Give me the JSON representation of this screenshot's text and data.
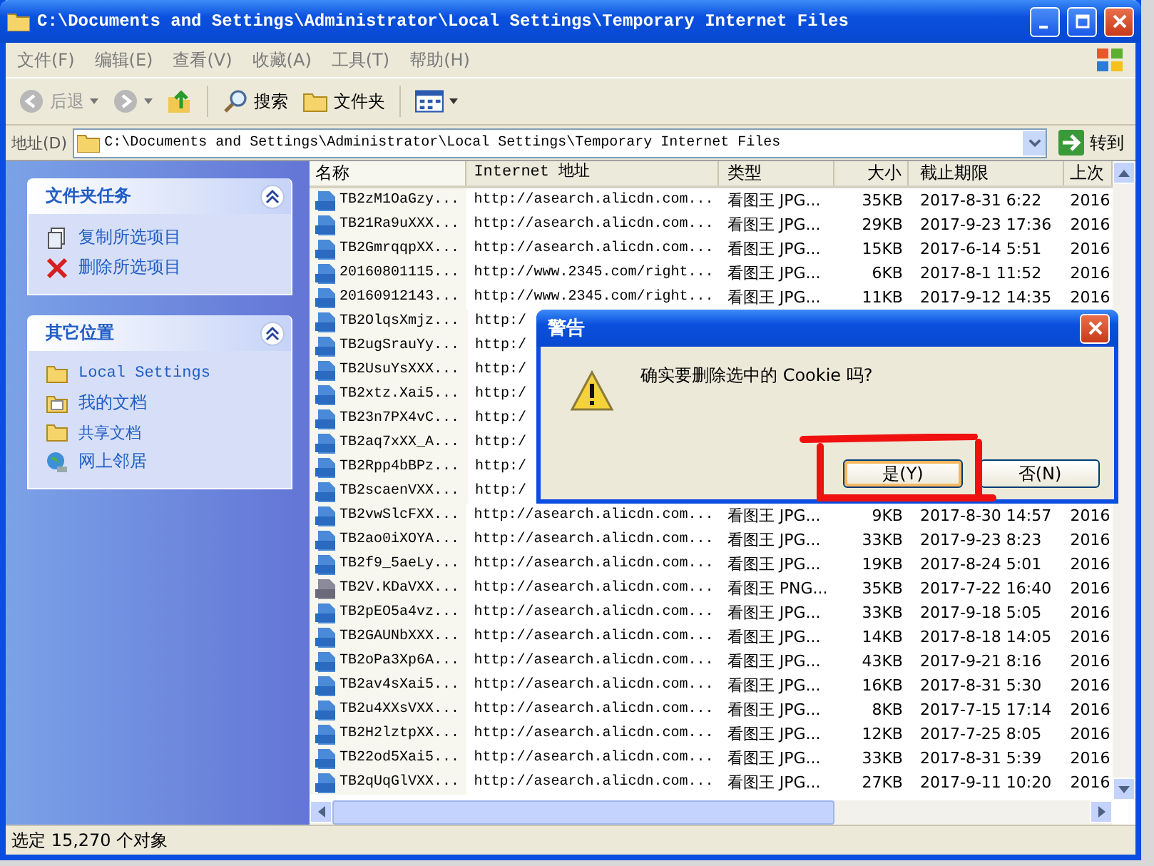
{
  "window": {
    "title": "C:\\Documents and Settings\\Administrator\\Local Settings\\Temporary Internet Files"
  },
  "menu": [
    "文件(F)",
    "编辑(E)",
    "查看(V)",
    "收藏(A)",
    "工具(T)",
    "帮助(H)"
  ],
  "toolbar": [
    {
      "kind": "back",
      "label": "后退",
      "disabled": true
    },
    {
      "kind": "forward",
      "disabled": true
    },
    {
      "kind": "up"
    },
    {
      "kind": "search",
      "label": "搜索"
    },
    {
      "kind": "folders",
      "label": "文件夹"
    },
    {
      "kind": "views"
    }
  ],
  "address": {
    "label": "地址(D)",
    "value": "C:\\Documents and Settings\\Administrator\\Local Settings\\Temporary Internet Files",
    "go": "转到"
  },
  "sidebar": [
    {
      "title": "文件夹任务",
      "items": [
        {
          "kind": "copy",
          "label": "复制所选项目"
        },
        {
          "kind": "delete",
          "label": "删除所选项目"
        }
      ]
    },
    {
      "title": "其它位置",
      "items": [
        {
          "kind": "folder",
          "label": "Local Settings"
        },
        {
          "kind": "documents",
          "label": "我的文档"
        },
        {
          "kind": "folder",
          "label": "共享文档"
        },
        {
          "kind": "network",
          "label": "网上邻居"
        }
      ]
    }
  ],
  "table": {
    "columns": [
      "名称",
      "Internet 地址",
      "类型",
      "大小",
      "截止期限",
      "上次"
    ],
    "rows": [
      {
        "kind": "jpg",
        "name": "TB2zM1OaGzy...",
        "url": "http://asearch.alicdn.com...",
        "type": "看图王 JPG...",
        "size": "35KB",
        "expires": "2017-8-31 6:22",
        "column_6": "2016"
      },
      {
        "kind": "jpg",
        "name": "TB21Ra9uXXX...",
        "url": "http://asearch.alicdn.com...",
        "type": "看图王 JPG...",
        "size": "29KB",
        "expires": "2017-9-23 17:36",
        "column_6": "2016"
      },
      {
        "kind": "jpg",
        "name": "TB2GmrqqpXX...",
        "url": "http://asearch.alicdn.com...",
        "type": "看图王 JPG...",
        "size": "15KB",
        "expires": "2017-6-14 5:51",
        "column_6": "2016"
      },
      {
        "kind": "jpg",
        "name": "20160801115...",
        "url": "http://www.2345.com/right...",
        "type": "看图王 JPG...",
        "size": "6KB",
        "expires": "2017-8-1 11:52",
        "column_6": "2016"
      },
      {
        "kind": "jpg",
        "name": "20160912143...",
        "url": "http://www.2345.com/right...",
        "type": "看图王 JPG...",
        "size": "11KB",
        "expires": "2017-9-12 14:35",
        "column_6": "2016"
      },
      {
        "kind": "jpg",
        "name": "TB2OlqsXmjz...",
        "url": "http:/"
      },
      {
        "kind": "jpg",
        "name": "TB2ugSrauYy...",
        "url": "http:/"
      },
      {
        "kind": "jpg",
        "name": "TB2UsuYsXXX...",
        "url": "http:/"
      },
      {
        "kind": "jpg",
        "name": "TB2xtz.Xai5...",
        "url": "http:/"
      },
      {
        "kind": "jpg",
        "name": "TB23n7PX4vC...",
        "url": "http:/"
      },
      {
        "kind": "jpg",
        "name": "TB2aq7xXX_A...",
        "url": "http:/"
      },
      {
        "kind": "jpg",
        "name": "TB2Rpp4bBPz...",
        "url": "http:/"
      },
      {
        "kind": "jpg",
        "name": "TB2scaenVXX...",
        "url": "http:/"
      },
      {
        "kind": "jpg",
        "name": "TB2vwSlcFXX...",
        "url": "http://asearch.alicdn.com...",
        "type": "看图王 JPG...",
        "size": "9KB",
        "expires": "2017-8-30 14:57",
        "column_6": "2016"
      },
      {
        "kind": "jpg",
        "name": "TB2ao0iXOYA...",
        "url": "http://asearch.alicdn.com...",
        "type": "看图王 JPG...",
        "size": "33KB",
        "expires": "2017-9-23 8:23",
        "column_6": "2016"
      },
      {
        "kind": "jpg",
        "name": "TB2f9_5aeLy...",
        "url": "http://asearch.alicdn.com...",
        "type": "看图王 JPG...",
        "size": "19KB",
        "expires": "2017-8-24 5:01",
        "column_6": "2016"
      },
      {
        "kind": "png",
        "name": "TB2V.KDaVXX...",
        "url": "http://asearch.alicdn.com...",
        "type": "看图王 PNG...",
        "size": "35KB",
        "expires": "2017-7-22 16:40",
        "column_6": "2016"
      },
      {
        "kind": "jpg",
        "name": "TB2pEO5a4vz...",
        "url": "http://asearch.alicdn.com...",
        "type": "看图王 JPG...",
        "size": "33KB",
        "expires": "2017-9-18 5:05",
        "column_6": "2016"
      },
      {
        "kind": "jpg",
        "name": "TB2GAUNbXXX...",
        "url": "http://asearch.alicdn.com...",
        "type": "看图王 JPG...",
        "size": "14KB",
        "expires": "2017-8-18 14:05",
        "column_6": "2016"
      },
      {
        "kind": "jpg",
        "name": "TB2oPa3Xp6A...",
        "url": "http://asearch.alicdn.com...",
        "type": "看图王 JPG...",
        "size": "43KB",
        "expires": "2017-9-21 8:16",
        "column_6": "2016"
      },
      {
        "kind": "jpg",
        "name": "TB2av4sXai5...",
        "url": "http://asearch.alicdn.com...",
        "type": "看图王 JPG...",
        "size": "16KB",
        "expires": "2017-8-31 5:30",
        "column_6": "2016"
      },
      {
        "kind": "jpg",
        "name": "TB2u4XXsVXX...",
        "url": "http://asearch.alicdn.com...",
        "type": "看图王 JPG...",
        "size": "8KB",
        "expires": "2017-7-15 17:14",
        "column_6": "2016"
      },
      {
        "kind": "jpg",
        "name": "TB2H2lztpXX...",
        "url": "http://asearch.alicdn.com...",
        "type": "看图王 JPG...",
        "size": "12KB",
        "expires": "2017-7-25 8:05",
        "column_6": "2016"
      },
      {
        "kind": "jpg",
        "name": "TB22od5Xai5...",
        "url": "http://asearch.alicdn.com...",
        "type": "看图王 JPG...",
        "size": "33KB",
        "expires": "2017-8-31 5:39",
        "column_6": "2016"
      },
      {
        "kind": "jpg",
        "name": "TB2qUqGlVXX...",
        "url": "http://asearch.alicdn.com...",
        "type": "看图王 JPG...",
        "size": "27KB",
        "expires": "2017-9-11 10:20",
        "column_6": "2016"
      }
    ]
  },
  "status_bar": "选定 15,270 个对象",
  "dialog": {
    "title": "警告",
    "message": "确实要删除选中的 Cookie 吗?",
    "buttons": [
      {
        "label": "是(Y)",
        "selected": true
      },
      {
        "label": "否(N)",
        "selected": false
      }
    ]
  }
}
